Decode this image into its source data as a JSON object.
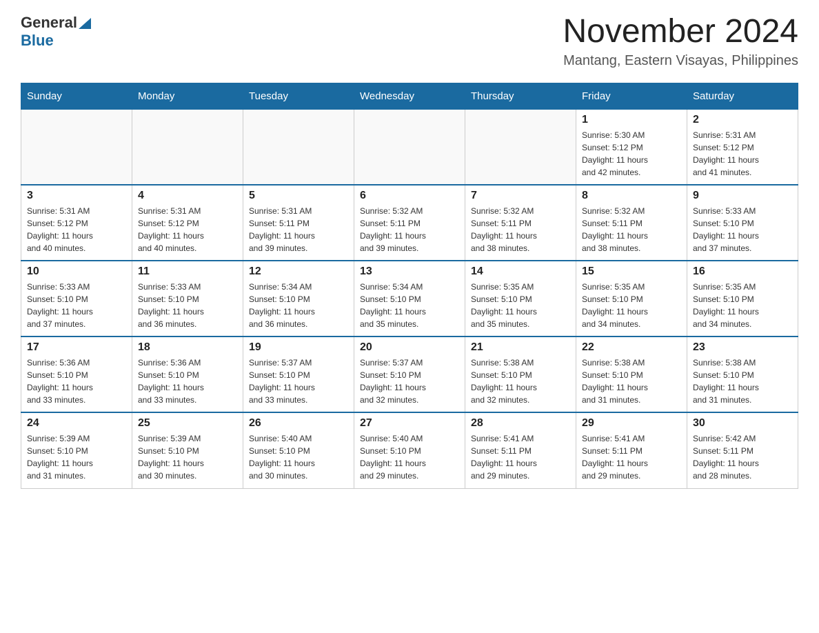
{
  "logo": {
    "text_general": "General",
    "text_blue": "Blue",
    "triangle_color": "#1a6aa0"
  },
  "header": {
    "title": "November 2024",
    "subtitle": "Mantang, Eastern Visayas, Philippines"
  },
  "weekdays": [
    "Sunday",
    "Monday",
    "Tuesday",
    "Wednesday",
    "Thursday",
    "Friday",
    "Saturday"
  ],
  "weeks": [
    {
      "days": [
        {
          "num": "",
          "info": ""
        },
        {
          "num": "",
          "info": ""
        },
        {
          "num": "",
          "info": ""
        },
        {
          "num": "",
          "info": ""
        },
        {
          "num": "",
          "info": ""
        },
        {
          "num": "1",
          "info": "Sunrise: 5:30 AM\nSunset: 5:12 PM\nDaylight: 11 hours\nand 42 minutes."
        },
        {
          "num": "2",
          "info": "Sunrise: 5:31 AM\nSunset: 5:12 PM\nDaylight: 11 hours\nand 41 minutes."
        }
      ]
    },
    {
      "days": [
        {
          "num": "3",
          "info": "Sunrise: 5:31 AM\nSunset: 5:12 PM\nDaylight: 11 hours\nand 40 minutes."
        },
        {
          "num": "4",
          "info": "Sunrise: 5:31 AM\nSunset: 5:12 PM\nDaylight: 11 hours\nand 40 minutes."
        },
        {
          "num": "5",
          "info": "Sunrise: 5:31 AM\nSunset: 5:11 PM\nDaylight: 11 hours\nand 39 minutes."
        },
        {
          "num": "6",
          "info": "Sunrise: 5:32 AM\nSunset: 5:11 PM\nDaylight: 11 hours\nand 39 minutes."
        },
        {
          "num": "7",
          "info": "Sunrise: 5:32 AM\nSunset: 5:11 PM\nDaylight: 11 hours\nand 38 minutes."
        },
        {
          "num": "8",
          "info": "Sunrise: 5:32 AM\nSunset: 5:11 PM\nDaylight: 11 hours\nand 38 minutes."
        },
        {
          "num": "9",
          "info": "Sunrise: 5:33 AM\nSunset: 5:10 PM\nDaylight: 11 hours\nand 37 minutes."
        }
      ]
    },
    {
      "days": [
        {
          "num": "10",
          "info": "Sunrise: 5:33 AM\nSunset: 5:10 PM\nDaylight: 11 hours\nand 37 minutes."
        },
        {
          "num": "11",
          "info": "Sunrise: 5:33 AM\nSunset: 5:10 PM\nDaylight: 11 hours\nand 36 minutes."
        },
        {
          "num": "12",
          "info": "Sunrise: 5:34 AM\nSunset: 5:10 PM\nDaylight: 11 hours\nand 36 minutes."
        },
        {
          "num": "13",
          "info": "Sunrise: 5:34 AM\nSunset: 5:10 PM\nDaylight: 11 hours\nand 35 minutes."
        },
        {
          "num": "14",
          "info": "Sunrise: 5:35 AM\nSunset: 5:10 PM\nDaylight: 11 hours\nand 35 minutes."
        },
        {
          "num": "15",
          "info": "Sunrise: 5:35 AM\nSunset: 5:10 PM\nDaylight: 11 hours\nand 34 minutes."
        },
        {
          "num": "16",
          "info": "Sunrise: 5:35 AM\nSunset: 5:10 PM\nDaylight: 11 hours\nand 34 minutes."
        }
      ]
    },
    {
      "days": [
        {
          "num": "17",
          "info": "Sunrise: 5:36 AM\nSunset: 5:10 PM\nDaylight: 11 hours\nand 33 minutes."
        },
        {
          "num": "18",
          "info": "Sunrise: 5:36 AM\nSunset: 5:10 PM\nDaylight: 11 hours\nand 33 minutes."
        },
        {
          "num": "19",
          "info": "Sunrise: 5:37 AM\nSunset: 5:10 PM\nDaylight: 11 hours\nand 33 minutes."
        },
        {
          "num": "20",
          "info": "Sunrise: 5:37 AM\nSunset: 5:10 PM\nDaylight: 11 hours\nand 32 minutes."
        },
        {
          "num": "21",
          "info": "Sunrise: 5:38 AM\nSunset: 5:10 PM\nDaylight: 11 hours\nand 32 minutes."
        },
        {
          "num": "22",
          "info": "Sunrise: 5:38 AM\nSunset: 5:10 PM\nDaylight: 11 hours\nand 31 minutes."
        },
        {
          "num": "23",
          "info": "Sunrise: 5:38 AM\nSunset: 5:10 PM\nDaylight: 11 hours\nand 31 minutes."
        }
      ]
    },
    {
      "days": [
        {
          "num": "24",
          "info": "Sunrise: 5:39 AM\nSunset: 5:10 PM\nDaylight: 11 hours\nand 31 minutes."
        },
        {
          "num": "25",
          "info": "Sunrise: 5:39 AM\nSunset: 5:10 PM\nDaylight: 11 hours\nand 30 minutes."
        },
        {
          "num": "26",
          "info": "Sunrise: 5:40 AM\nSunset: 5:10 PM\nDaylight: 11 hours\nand 30 minutes."
        },
        {
          "num": "27",
          "info": "Sunrise: 5:40 AM\nSunset: 5:10 PM\nDaylight: 11 hours\nand 29 minutes."
        },
        {
          "num": "28",
          "info": "Sunrise: 5:41 AM\nSunset: 5:11 PM\nDaylight: 11 hours\nand 29 minutes."
        },
        {
          "num": "29",
          "info": "Sunrise: 5:41 AM\nSunset: 5:11 PM\nDaylight: 11 hours\nand 29 minutes."
        },
        {
          "num": "30",
          "info": "Sunrise: 5:42 AM\nSunset: 5:11 PM\nDaylight: 11 hours\nand 28 minutes."
        }
      ]
    }
  ]
}
